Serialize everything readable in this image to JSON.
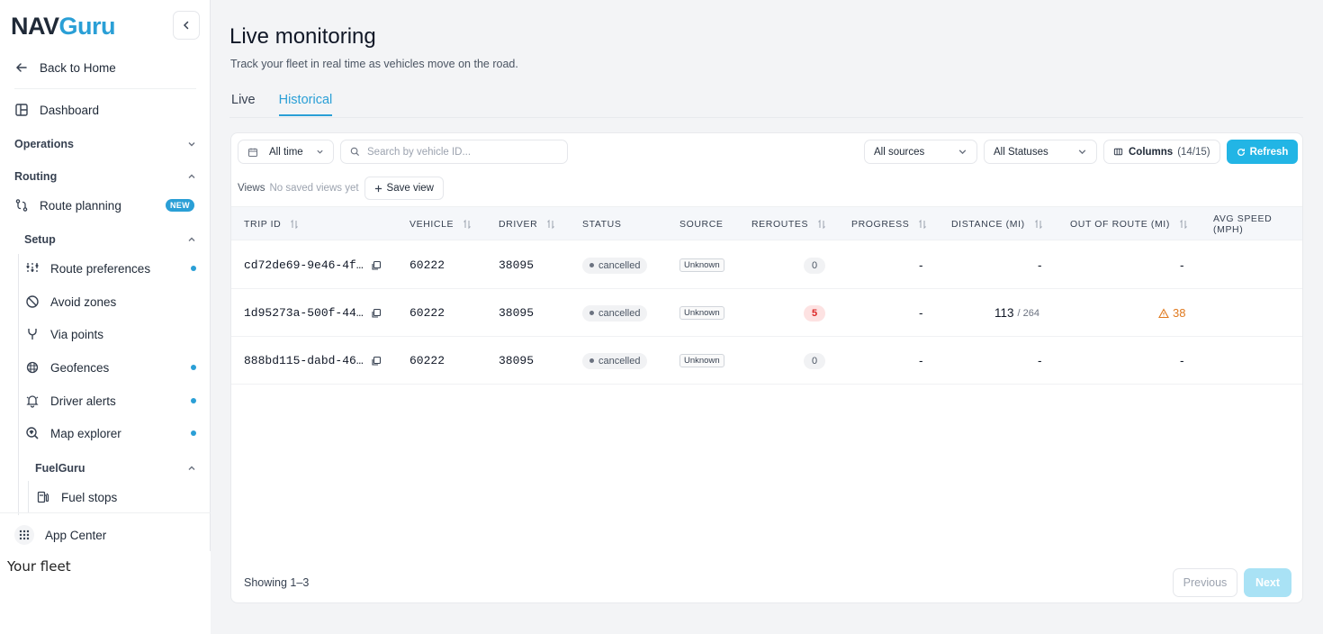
{
  "brand": {
    "part1": "NAV",
    "part2": "Guru",
    "accent": "#2a9fd6"
  },
  "sidebar": {
    "back_label": "Back to Home",
    "dashboard_label": "Dashboard",
    "operations_label": "Operations",
    "routing_label": "Routing",
    "route_planning_label": "Route planning",
    "new_badge": "NEW",
    "setup_label": "Setup",
    "setup_items": [
      {
        "label": "Route preferences",
        "icon": "sliders-icon",
        "dot": true
      },
      {
        "label": "Avoid zones",
        "icon": "ban-icon",
        "dot": false
      },
      {
        "label": "Via points",
        "icon": "fork-icon",
        "dot": false
      },
      {
        "label": "Geofences",
        "icon": "grid-globe-icon",
        "dot": true
      },
      {
        "label": "Driver alerts",
        "icon": "bell-icon",
        "dot": true
      },
      {
        "label": "Map explorer",
        "icon": "map-search-icon",
        "dot": true
      }
    ],
    "fuelguru_label": "FuelGuru",
    "fuel_stops_label": "Fuel stops",
    "app_center_label": "App Center",
    "your_fleet_label": "Your fleet"
  },
  "header": {
    "title": "Live monitoring",
    "subtitle": "Track your fleet in real time as vehicles move on the road."
  },
  "tabs": [
    {
      "label": "Live",
      "active": false
    },
    {
      "label": "Historical",
      "active": true
    }
  ],
  "toolbar": {
    "time_filter": "All time",
    "search_placeholder": "Search by vehicle ID...",
    "sources": "All sources",
    "statuses": "All Statuses",
    "columns_label": "Columns",
    "columns_count": "(14/15)",
    "refresh_label": "Refresh"
  },
  "views": {
    "label": "Views",
    "none": "No saved views yet",
    "save_label": "Save view"
  },
  "table": {
    "columns": [
      "TRIP ID",
      "VEHICLE",
      "DRIVER",
      "STATUS",
      "SOURCE",
      "REROUTES",
      "PROGRESS",
      "DISTANCE (MI)",
      "OUT OF ROUTE (MI)",
      "AVG SPEED (MPH)"
    ],
    "rows": [
      {
        "trip_id": "cd72de69-9e46-4f…",
        "vehicle": "60222",
        "driver": "38095",
        "status": "cancelled",
        "source": "Unknown",
        "reroutes": "0",
        "progress": "-",
        "distance": "-",
        "distance_total": "",
        "out_of_route": "-"
      },
      {
        "trip_id": "1d95273a-500f-44…",
        "vehicle": "60222",
        "driver": "38095",
        "status": "cancelled",
        "source": "Unknown",
        "reroutes": "5",
        "progress": "-",
        "distance": "113",
        "distance_total": "/ 264",
        "out_of_route": "38"
      },
      {
        "trip_id": "888bd115-dabd-46…",
        "vehicle": "60222",
        "driver": "38095",
        "status": "cancelled",
        "source": "Unknown",
        "reroutes": "0",
        "progress": "-",
        "distance": "-",
        "distance_total": "",
        "out_of_route": "-"
      }
    ]
  },
  "footer": {
    "showing": "Showing 1–3",
    "previous": "Previous",
    "next": "Next"
  }
}
